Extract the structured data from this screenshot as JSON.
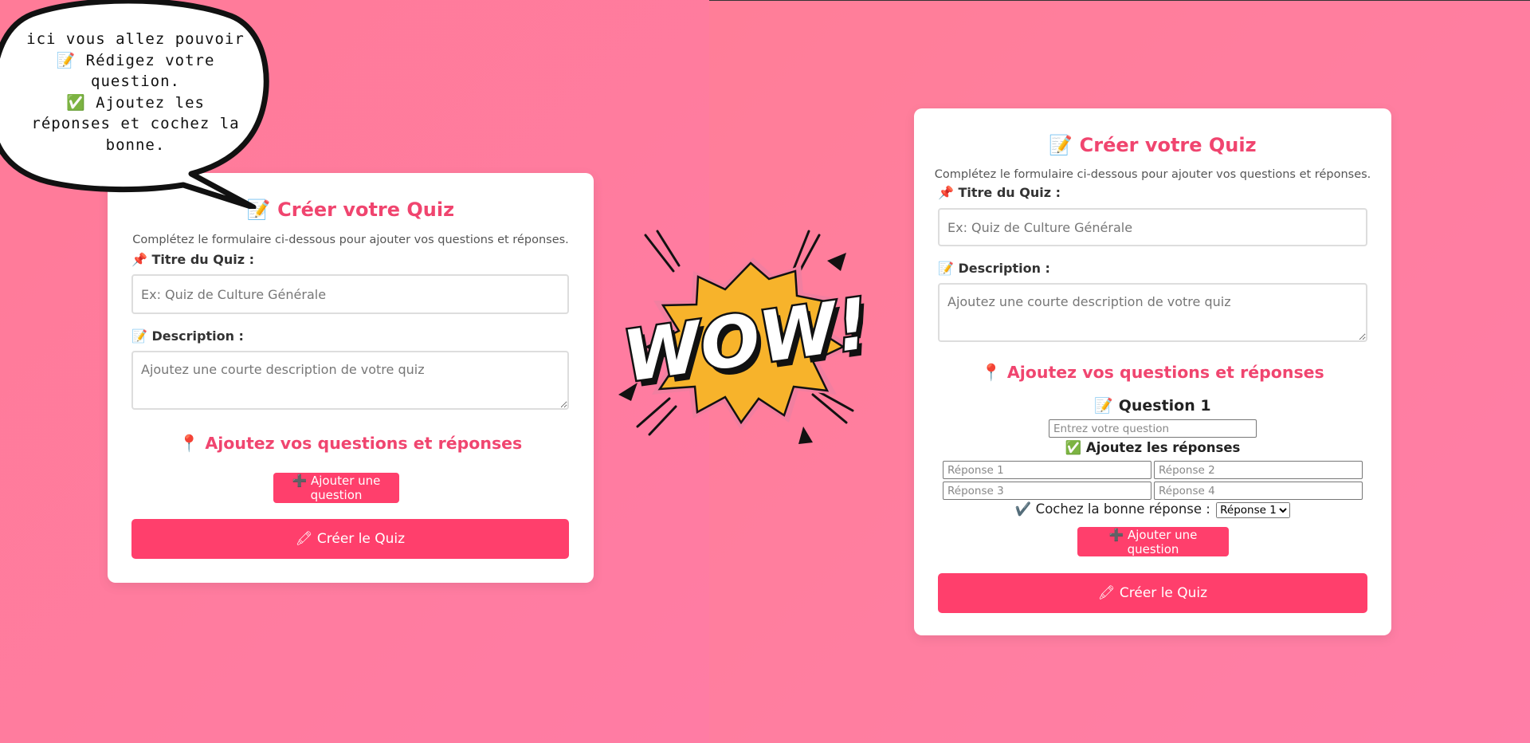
{
  "colors": {
    "accent": "#ff3f6c",
    "title": "#f0456f",
    "background": "#ff7ca0"
  },
  "bubble": {
    "line1": "ici vous allez pouvoir",
    "line2": "📝 Rédigez votre",
    "line3": "question.",
    "line4": "✅ Ajoutez les",
    "line5": "réponses et cochez la",
    "line6": "bonne."
  },
  "wow": {
    "text": "WOW!"
  },
  "form": {
    "title": "📝 Créer votre Quiz",
    "subtitle": "Complétez le formulaire ci-dessous pour ajouter vos questions et réponses.",
    "title_label": "📌 Titre du Quiz :",
    "title_placeholder": "Ex: Quiz de Culture Générale",
    "description_label": "📝 Description :",
    "description_placeholder": "Ajoutez une courte description de votre quiz",
    "questions_heading": "📍 Ajoutez vos questions et réponses",
    "add_question_button": "➕ Ajouter une question",
    "create_button": "🖍 Créer le Quiz"
  },
  "question": {
    "title": "📝 Question 1",
    "question_placeholder": "Entrez votre question",
    "answers_title": "✅ Ajoutez les réponses",
    "answer_placeholders": [
      "Réponse 1",
      "Réponse 2",
      "Réponse 3",
      "Réponse 4"
    ],
    "correct_label": "✔️ Cochez la bonne réponse :",
    "correct_options": [
      "Réponse 1",
      "Réponse 2",
      "Réponse 3",
      "Réponse 4"
    ],
    "correct_selected": "Réponse 1"
  }
}
